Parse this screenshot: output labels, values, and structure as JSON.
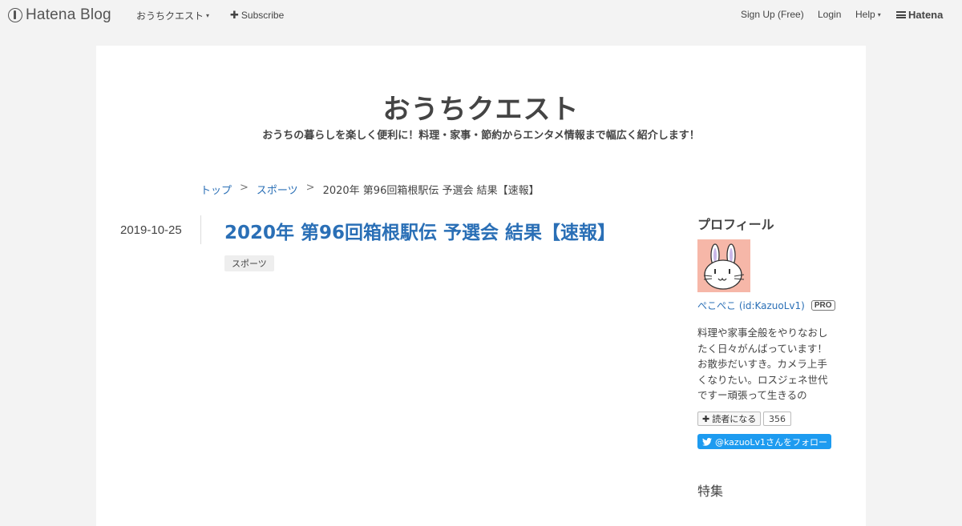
{
  "global_header": {
    "logo_text": "Hatena Blog",
    "blog_menu_label": "おうちクエスト",
    "subscribe_label": "Subscribe",
    "signup_label": "Sign Up (Free)",
    "login_label": "Login",
    "help_label": "Help",
    "hatena_label": "Hatena"
  },
  "blog": {
    "title": "おうちクエスト",
    "description": "おうちの暮らしを楽しく便利に！料理・家事・節約からエンタメ情報まで幅広く紹介します！"
  },
  "breadcrumb": {
    "items": [
      "トップ",
      "スポーツ",
      "2020年 第96回箱根駅伝 予選会 結果【速報】"
    ],
    "separator": ">"
  },
  "entry": {
    "date": "2019-10-25",
    "title": "2020年 第96回箱根駅伝 予選会 結果【速報】",
    "category": "スポーツ"
  },
  "sidebar": {
    "profile_heading": "プロフィール",
    "profile_name": "ぺこぺこ (id:KazuoLv1)",
    "pro_badge": "PRO",
    "profile_description": "料理や家事全般をやりなおしたく日々がんばっています！お散歩だいすき。カメラ上手くなりたい。ロスジェネ世代ですー頑張って生きるの",
    "reader_button_label": "読者になる",
    "reader_count": "356",
    "twitter_follow_label": "@kazuoLv1さんをフォロー",
    "feature_heading": "特集"
  },
  "colors": {
    "link": "#2a6fb6",
    "twitter": "#1d9bf0",
    "background": "#f3f3f3"
  }
}
